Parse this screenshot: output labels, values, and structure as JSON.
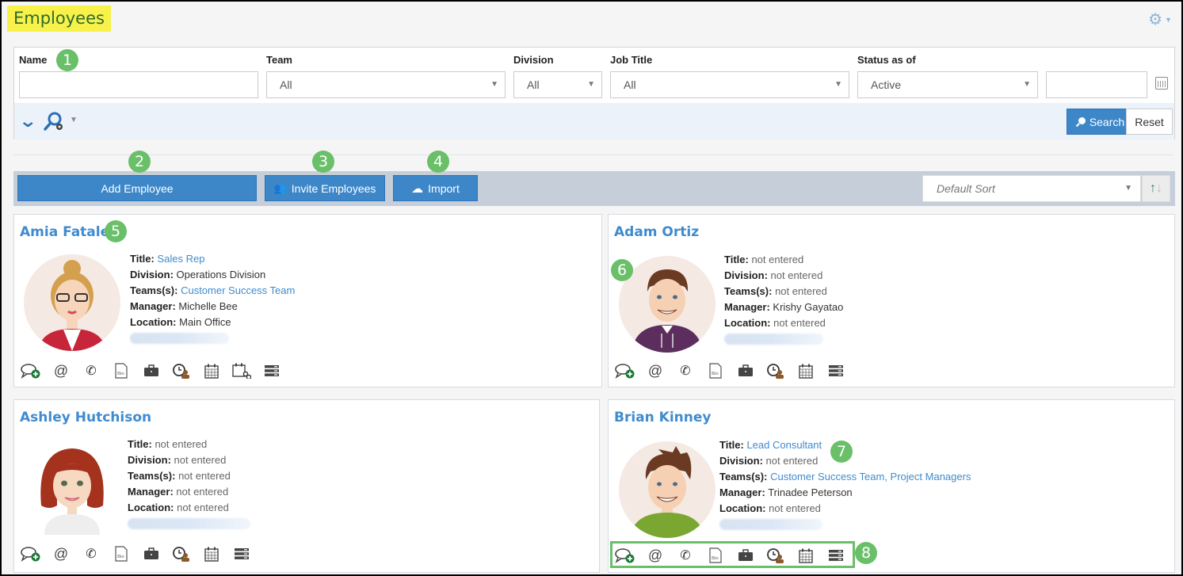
{
  "page": {
    "title": "Employees"
  },
  "settings": {
    "icon": "gear-icon"
  },
  "filters": {
    "name": {
      "label": "Name",
      "value": "",
      "placeholder": ""
    },
    "team": {
      "label": "Team",
      "value": "All"
    },
    "division": {
      "label": "Division",
      "value": "All"
    },
    "job_title": {
      "label": "Job Title",
      "value": "All"
    },
    "status": {
      "label": "Status as of",
      "value": "Active"
    },
    "status_date": {
      "value": ""
    },
    "search_label": "Search",
    "reset_label": "Reset"
  },
  "actions": {
    "add_employee": "Add Employee",
    "invite_employees": "Invite Employees",
    "import": "Import",
    "sort": {
      "value": "Default Sort"
    }
  },
  "labels": {
    "title": "Title:",
    "division": "Division:",
    "teams": "Teams(s):",
    "manager": "Manager:",
    "location": "Location:"
  },
  "employees": [
    {
      "name": "Amia Fatale",
      "title": "Sales Rep",
      "division": "Operations Division",
      "teams": "Customer Success Team",
      "manager": "Michelle Bee",
      "location": "Main Office",
      "icons": [
        "chat-add-icon",
        "email-icon",
        "phone-icon",
        "bio-icon",
        "briefcase-icon",
        "time-off-icon",
        "calendar-icon",
        "calendar-link-icon",
        "list-icon"
      ]
    },
    {
      "name": "Adam Ortiz",
      "title": "not entered",
      "division": "not entered",
      "teams": "not entered",
      "manager": "Krishy Gayatao",
      "location": "not entered",
      "icons": [
        "chat-add-icon",
        "email-icon",
        "phone-icon",
        "bio-icon",
        "briefcase-icon",
        "time-off-icon",
        "calendar-icon",
        "list-icon"
      ]
    },
    {
      "name": "Ashley Hutchison",
      "title": "not entered",
      "division": "not entered",
      "teams": "not entered",
      "manager": "not entered",
      "location": "not entered",
      "icons": [
        "chat-add-icon",
        "email-icon",
        "phone-icon",
        "bio-icon",
        "briefcase-icon",
        "time-off-icon",
        "calendar-icon",
        "list-icon"
      ]
    },
    {
      "name": "Brian Kinney",
      "title": "Lead Consultant",
      "division": "not entered",
      "teams": "Customer Success Team, Project Managers",
      "manager": "Trinadee Peterson",
      "location": "not entered",
      "icons": [
        "chat-add-icon",
        "email-icon",
        "phone-icon",
        "bio-icon",
        "briefcase-icon",
        "time-off-icon",
        "calendar-icon",
        "list-icon"
      ]
    }
  ],
  "callouts": [
    "1",
    "2",
    "3",
    "4",
    "5",
    "6",
    "7",
    "8"
  ],
  "colors": {
    "accent": "#3d87c9",
    "link": "#3f8bcf",
    "callout": "#6abf69",
    "title_highlight": "#f7f14a"
  }
}
